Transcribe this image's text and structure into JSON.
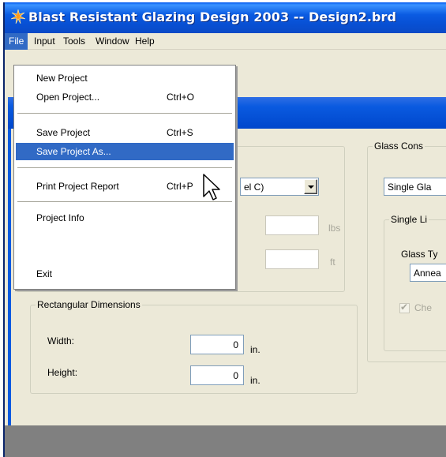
{
  "window": {
    "title": "Blast Resistant Glazing Design 2003 -- Design2.brd"
  },
  "menubar": {
    "items": [
      "File",
      "Input",
      "Tools",
      "Window",
      "Help"
    ]
  },
  "file_menu": {
    "items": [
      {
        "label": "New Project",
        "shortcut": ""
      },
      {
        "label": "Open Project...",
        "shortcut": "Ctrl+O"
      },
      {
        "label": "Save Project",
        "shortcut": "Ctrl+S"
      },
      {
        "label": "Save Project As...",
        "shortcut": ""
      },
      {
        "label": "Print Project Report",
        "shortcut": "Ctrl+P"
      },
      {
        "label": "Project Info",
        "shortcut": ""
      },
      {
        "label": "Exit",
        "shortcut": ""
      }
    ],
    "highlighted": "Save Project As..."
  },
  "left_panel": {
    "combo_value_fragment": "el C)",
    "weight_unit": "lbs",
    "distance_unit": "ft"
  },
  "rect_dims": {
    "title": "Rectangular Dimensions",
    "width_label": "Width:",
    "width_value": "0",
    "width_unit": "in.",
    "height_label": "Height:",
    "height_value": "0",
    "height_unit": "in."
  },
  "glass_panel": {
    "title_fragment": "Glass Cons",
    "combo_fragment": "Single Gla",
    "sub_title_fragment": "Single Li",
    "type_label_fragment": "Glass Ty",
    "type_value_fragment": "Annea",
    "check_label_fragment": "Che"
  },
  "colors": {
    "menu_highlight": "#316ac5",
    "titlebar": "#0a5be2",
    "face": "#ece9d8"
  }
}
